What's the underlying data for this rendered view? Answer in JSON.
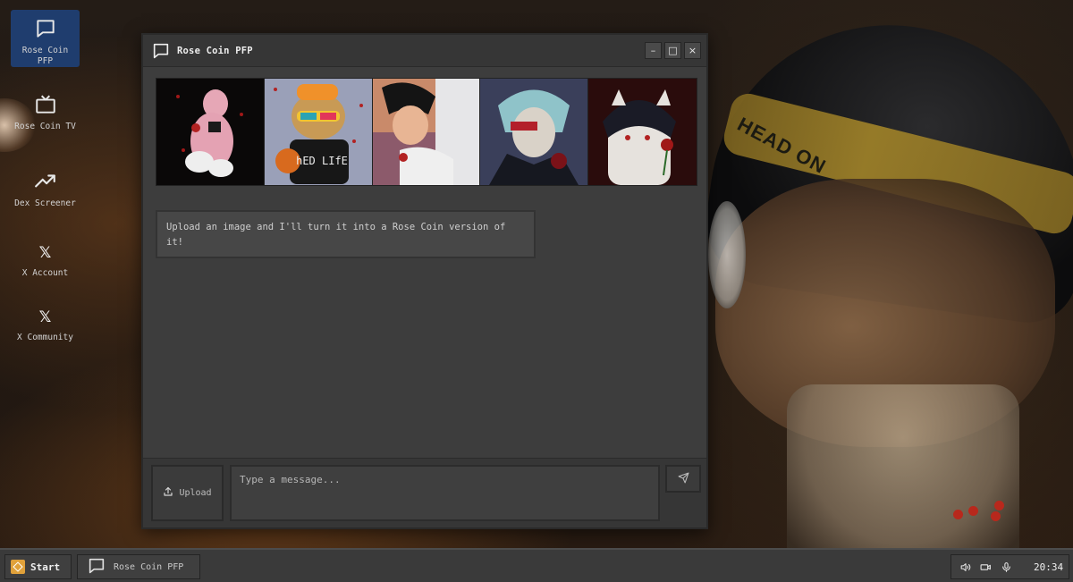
{
  "desktop": {
    "icons": [
      {
        "label": "Rose Coin PFP",
        "icon": "chat-icon",
        "selected": true
      },
      {
        "label": "Rose Coin TV",
        "icon": "tv-icon",
        "selected": false
      },
      {
        "label": "Dex Screener",
        "icon": "trending-up-icon",
        "selected": false
      },
      {
        "label": "X Account",
        "icon": "x-logo-icon",
        "selected": false
      },
      {
        "label": "X Community",
        "icon": "x-logo-icon",
        "selected": false
      }
    ],
    "wallpaper_text": "HEAD ON"
  },
  "window": {
    "title": "Rose Coin PFP",
    "controls": {
      "minimize": "–",
      "maximize": "□",
      "close": "×"
    },
    "gallery": [
      {
        "name": "pink-character-with-rose",
        "bg": "#0a0808"
      },
      {
        "name": "bear-with-basketball",
        "bg": "#9aa0b8",
        "shirt_text": "hED LIfE"
      },
      {
        "name": "anime-boy-with-rose",
        "bg": "#c98a6a"
      },
      {
        "name": "pale-villain-with-rose",
        "bg": "#3a3f5a"
      },
      {
        "name": "dark-haired-cat-with-rose",
        "bg": "#2a0c0c"
      }
    ],
    "message": "Upload an image and I'll turn it into a Rose Coin version of it!",
    "composer": {
      "upload_label": "Upload",
      "input_placeholder": "Type a message...",
      "input_value": ""
    }
  },
  "taskbar": {
    "start_label": "Start",
    "task_label": "Rose Coin PFP",
    "clock": "20:34",
    "tray_icons": [
      "volume-icon",
      "camera-icon",
      "microphone-icon"
    ]
  },
  "colors": {
    "accent_selected": "#1f3d6e",
    "window_bg": "#3d3d3d",
    "taskbar_bg": "#3a3a3a",
    "start_logo": "#e0a13a"
  }
}
